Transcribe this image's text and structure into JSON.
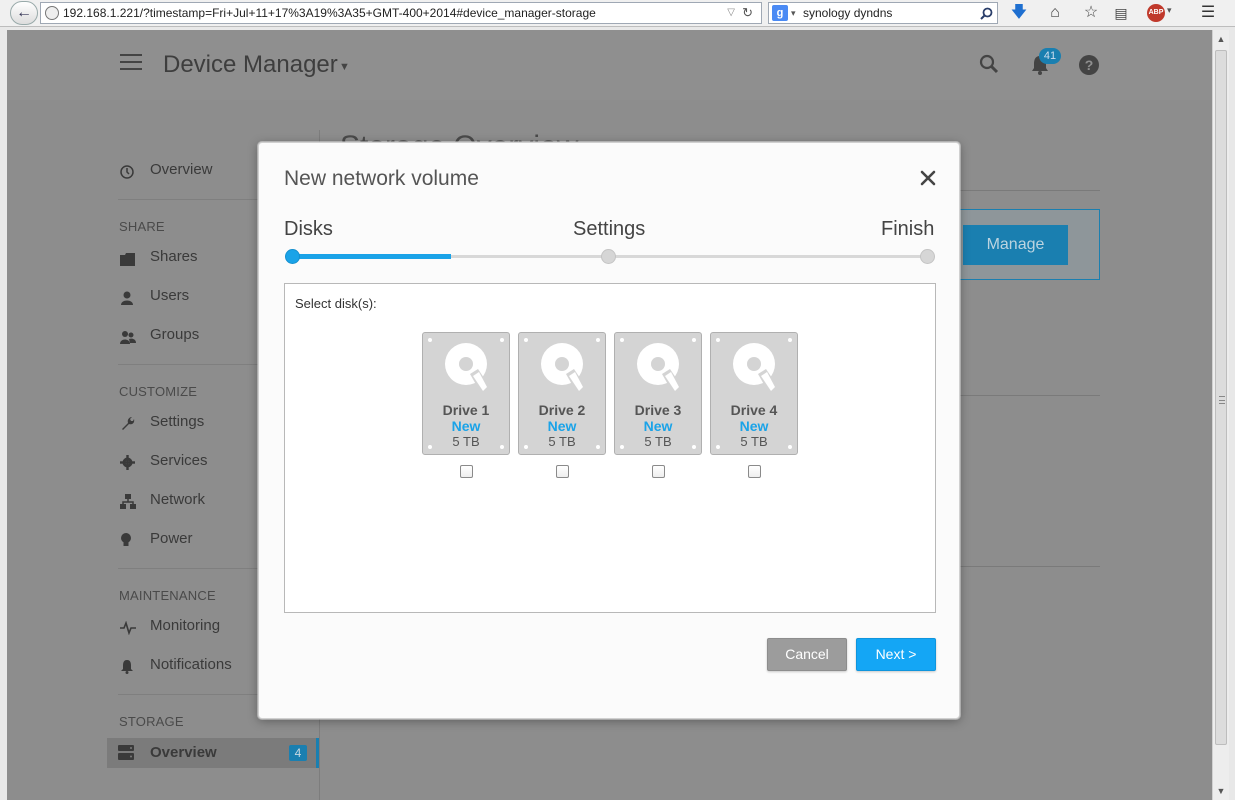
{
  "browser": {
    "url": "192.168.1.221/?timestamp=Fri+Jul+11+17%3A19%3A35+GMT-400+2014#device_manager-storage",
    "search_text": "synology dyndns",
    "search_engine": "g",
    "adblock_label": "ABP"
  },
  "header": {
    "title": "Device Manager",
    "notification_count": "41",
    "help_glyph": "?"
  },
  "sidebar": {
    "overview": "Overview",
    "sections": {
      "share": "SHARE",
      "customize": "CUSTOMIZE",
      "maintenance": "MAINTENANCE",
      "storage": "STORAGE"
    },
    "share_items": [
      "Shares",
      "Users",
      "Groups"
    ],
    "customize_items": [
      "Settings",
      "Services",
      "Network",
      "Power"
    ],
    "maintenance_items": [
      "Monitoring",
      "Notifications"
    ],
    "storage_active": {
      "label": "Overview",
      "badge": "4"
    }
  },
  "background": {
    "page_title": "Storage Overview",
    "manage_button": "Manage"
  },
  "modal": {
    "title": "New network volume",
    "steps": [
      "Disks",
      "Settings",
      "Finish"
    ],
    "current_step": 1,
    "step_progress": 0.25,
    "select_label": "Select disk(s):",
    "drives": [
      {
        "name": "Drive 1",
        "status": "New",
        "size": "5 TB",
        "checked": false
      },
      {
        "name": "Drive 2",
        "status": "New",
        "size": "5 TB",
        "checked": false
      },
      {
        "name": "Drive 3",
        "status": "New",
        "size": "5 TB",
        "checked": false
      },
      {
        "name": "Drive 4",
        "status": "New",
        "size": "5 TB",
        "checked": false
      }
    ],
    "cancel_label": "Cancel",
    "next_label": "Next >"
  },
  "colors": {
    "accent": "#1aa3e8",
    "overlay": "#8d8d8d"
  }
}
